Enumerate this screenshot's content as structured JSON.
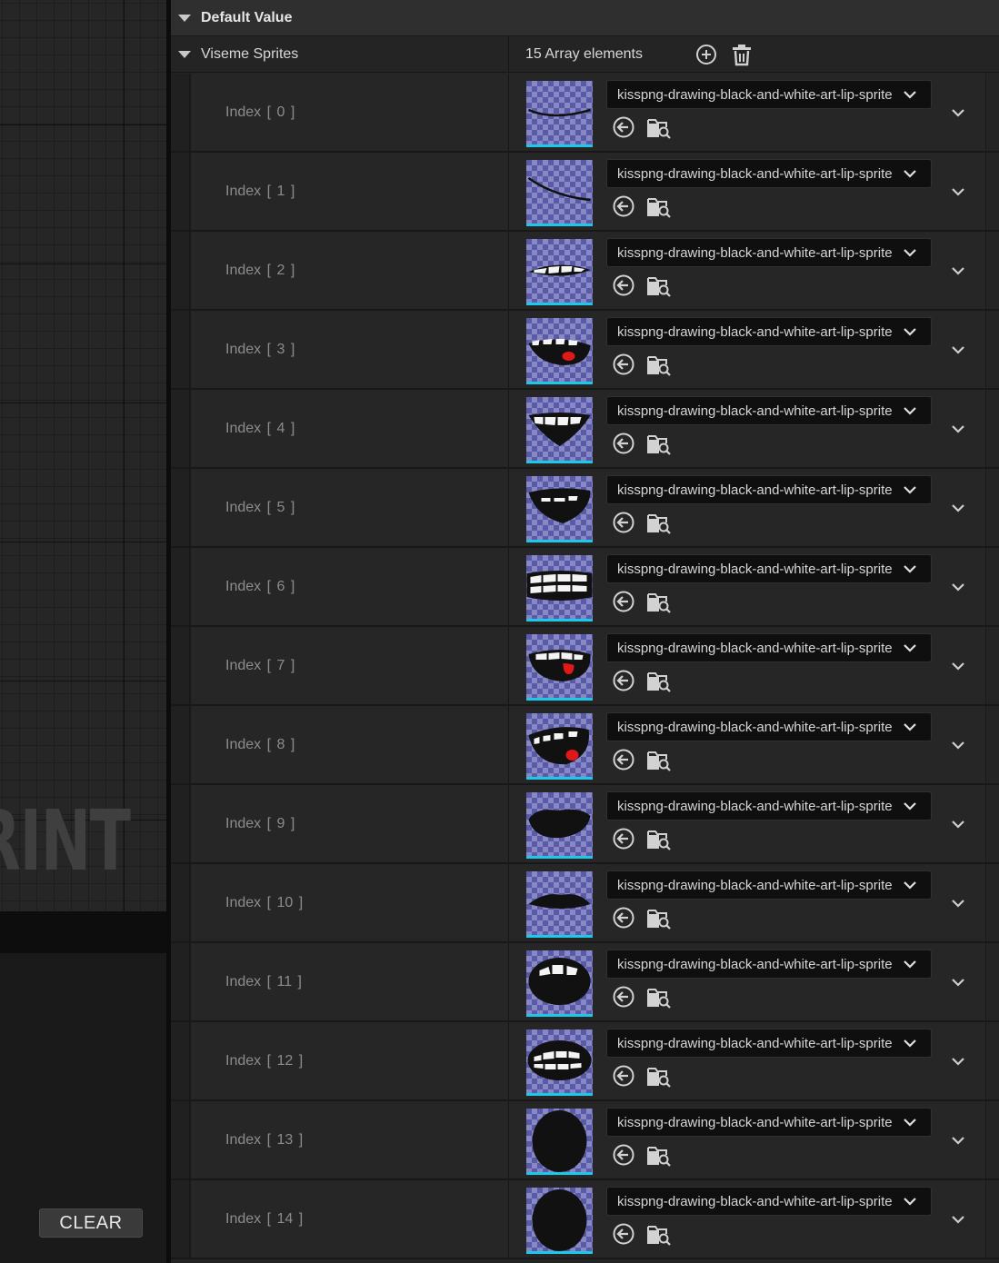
{
  "graph": {
    "watermark": "RINT",
    "clear_label": "CLEAR"
  },
  "details": {
    "section_title": "Default Value",
    "property_name": "Viseme Sprites",
    "array_count": "15 Array elements",
    "elements": [
      {
        "label": "Index [ 0 ]",
        "asset": "kisspng-drawing-black-and-white-art-lip-sprite",
        "mouth": "closed-line"
      },
      {
        "label": "Index [ 1 ]",
        "asset": "kisspng-drawing-black-and-white-art-lip-sprite",
        "mouth": "closed-line-tilt"
      },
      {
        "label": "Index [ 2 ]",
        "asset": "kisspng-drawing-black-and-white-art-lip-sprite",
        "mouth": "teeth-thin"
      },
      {
        "label": "Index [ 3 ]",
        "asset": "kisspng-drawing-black-and-white-art-lip-sprite",
        "mouth": "teeth-tongue"
      },
      {
        "label": "Index [ 4 ]",
        "asset": "kisspng-drawing-black-and-white-art-lip-sprite",
        "mouth": "open-triangle"
      },
      {
        "label": "Index [ 5 ]",
        "asset": "kisspng-drawing-black-and-white-art-lip-sprite",
        "mouth": "open-wide"
      },
      {
        "label": "Index [ 6 ]",
        "asset": "kisspng-drawing-black-and-white-art-lip-sprite",
        "mouth": "teeth-grid"
      },
      {
        "label": "Index [ 7 ]",
        "asset": "kisspng-drawing-black-and-white-art-lip-sprite",
        "mouth": "teeth-tongue-2"
      },
      {
        "label": "Index [ 8 ]",
        "asset": "kisspng-drawing-black-and-white-art-lip-sprite",
        "mouth": "open-tongue"
      },
      {
        "label": "Index [ 9 ]",
        "asset": "kisspng-drawing-black-and-white-art-lip-sprite",
        "mouth": "lips-closed"
      },
      {
        "label": "Index [ 10 ]",
        "asset": "kisspng-drawing-black-and-white-art-lip-sprite",
        "mouth": "lips-thin"
      },
      {
        "label": "Index [ 11 ]",
        "asset": "kisspng-drawing-black-and-white-art-lip-sprite",
        "mouth": "round-teeth"
      },
      {
        "label": "Index [ 12 ]",
        "asset": "kisspng-drawing-black-and-white-art-lip-sprite",
        "mouth": "teeth-grid-2"
      },
      {
        "label": "Index [ 13 ]",
        "asset": "kisspng-drawing-black-and-white-art-lip-sprite",
        "mouth": "oval"
      },
      {
        "label": "Index [ 14 ]",
        "asset": "kisspng-drawing-black-and-white-art-lip-sprite",
        "mouth": "oval"
      }
    ]
  },
  "colors": {
    "thumbnail_underline": "#1ec8e8",
    "tongue": "#e01818"
  },
  "icons": {
    "add": "plus-circle-icon",
    "delete": "trash-icon",
    "use_selected": "arrow-left-circle-icon",
    "browse": "folder-search-icon",
    "combo": "chevron-down-icon",
    "expand": "chevron-down-icon"
  }
}
